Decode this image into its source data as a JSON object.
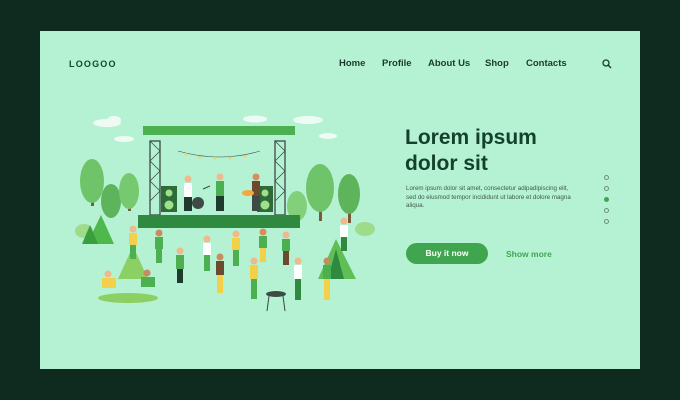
{
  "brand": {
    "logo": "LOOGOO"
  },
  "nav": {
    "items": [
      {
        "label": "Home"
      },
      {
        "label": "Profile"
      },
      {
        "label": "About Us"
      },
      {
        "label": "Shop"
      },
      {
        "label": "Contacts"
      }
    ],
    "search_icon": "search-icon"
  },
  "hero": {
    "title_line1": "Lorem ipsum",
    "title_line2": "dolor sit",
    "description": "Lorem ipsum dolor sit amet, consectetur adipadipiscing elit, sed do eiusmod tempor incididunt ut labore et dolore magna aliqua.",
    "primary_button": "Buy it now",
    "secondary_button": "Show more"
  },
  "pagination": {
    "count": 5,
    "active_index": 2
  },
  "colors": {
    "background": "#b5f2d4",
    "frame": "#0f2a1f",
    "accent": "#3fa64f",
    "heading": "#13412c"
  }
}
